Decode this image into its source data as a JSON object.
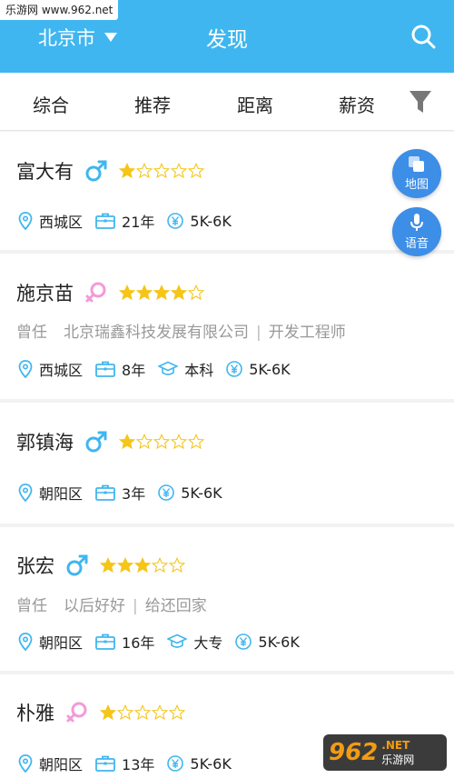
{
  "watermark_top": "乐游网 www.962.net",
  "header": {
    "city": "北京市",
    "title": "发现",
    "bg_color": "#3fb6ef"
  },
  "tabs": [
    "综合",
    "推荐",
    "距离",
    "薪资"
  ],
  "fab": {
    "map_label": "地图",
    "voice_label": "语音"
  },
  "candidates": [
    {
      "name": "富大有",
      "gender": "male",
      "rating": 1,
      "prev": null,
      "district": "西城区",
      "experience": "21年",
      "education": null,
      "salary": "5K-6K"
    },
    {
      "name": "施京苗",
      "gender": "female",
      "rating": 4,
      "prev": {
        "label": "曾任",
        "company": "北京瑞鑫科技发展有限公司",
        "position": "开发工程师"
      },
      "district": "西城区",
      "experience": "8年",
      "education": "本科",
      "salary": "5K-6K"
    },
    {
      "name": "郭镇海",
      "gender": "male",
      "rating": 1,
      "prev": null,
      "district": "朝阳区",
      "experience": "3年",
      "education": null,
      "salary": "5K-6K"
    },
    {
      "name": "张宏",
      "gender": "male",
      "rating": 3,
      "prev": {
        "label": "曾任",
        "company": "以后好好",
        "position": "给还回家"
      },
      "district": "朝阳区",
      "experience": "16年",
      "education": "大专",
      "salary": "5K-6K"
    },
    {
      "name": "朴雅",
      "gender": "female",
      "rating": 1,
      "prev": null,
      "district": "朝阳区",
      "experience": "13年",
      "education": null,
      "salary": "5K-6K"
    }
  ],
  "watermark_br": {
    "big": "962",
    "net": ".NET",
    "cn": "乐游网"
  },
  "icons": {
    "search": "search-icon",
    "filter": "filter-icon",
    "location": "location-pin-icon",
    "experience": "briefcase-icon",
    "education": "graduation-cap-icon",
    "salary": "yen-icon",
    "male": "male-symbol-icon",
    "female": "female-symbol-icon",
    "star": "star-icon",
    "map": "map-layers-icon",
    "mic": "microphone-icon"
  },
  "colors": {
    "male": "#3fb6ef",
    "female": "#f39ad8",
    "star": "#f5c518",
    "info_icon": "#3fb6ef",
    "fab": "#3d8ee6"
  }
}
